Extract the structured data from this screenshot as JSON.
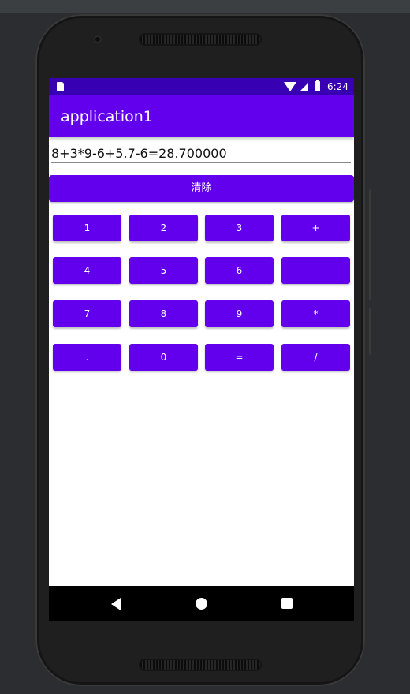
{
  "colors": {
    "status_bar": "#3700b3",
    "app_bar": "#6200ee",
    "button": "#6200ee",
    "nav_bar": "#000000"
  },
  "status_bar": {
    "time": "6:24",
    "icons": [
      "sd-card-icon",
      "wifi-icon",
      "signal-icon",
      "battery-icon"
    ]
  },
  "app_bar": {
    "title": "application1"
  },
  "display": {
    "expression": "8+3*9-6+5.7-6=28.700000"
  },
  "clear_button": {
    "label": "清除"
  },
  "keypad": {
    "rows": [
      [
        "1",
        "2",
        "3",
        "+"
      ],
      [
        "4",
        "5",
        "6",
        "-"
      ],
      [
        "7",
        "8",
        "9",
        "*"
      ],
      [
        ".",
        "0",
        "=",
        "/"
      ]
    ]
  },
  "nav_bar": {
    "icons": [
      "back-icon",
      "home-icon",
      "recents-icon"
    ]
  }
}
